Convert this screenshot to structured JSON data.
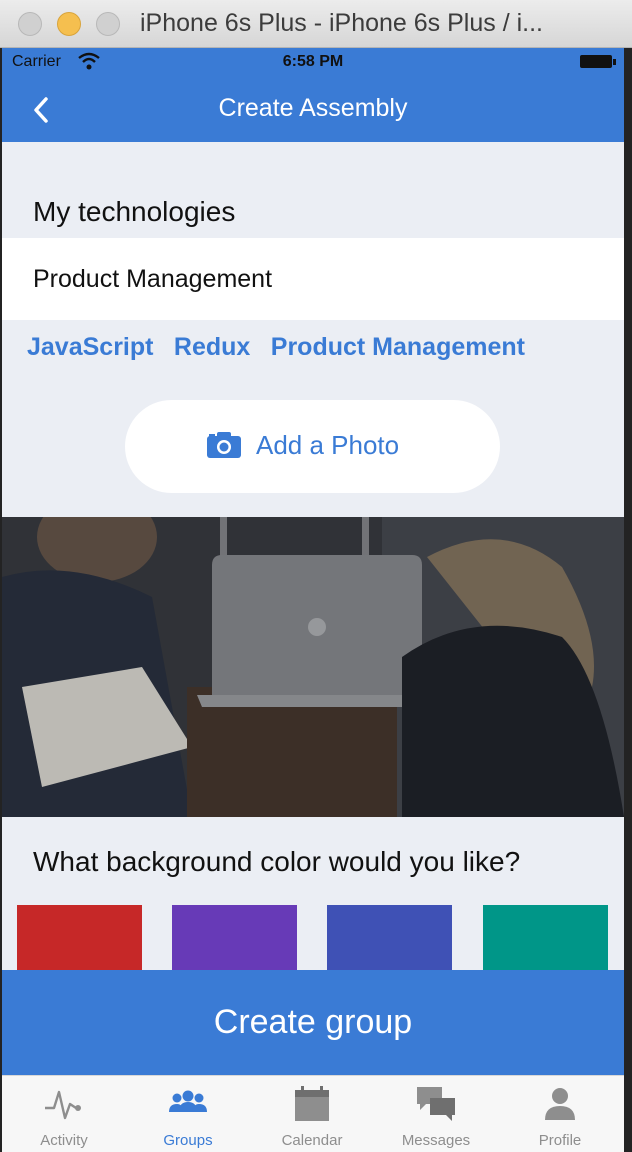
{
  "window": {
    "title": "iPhone 6s Plus - iPhone 6s Plus / i..."
  },
  "status_bar": {
    "carrier": "Carrier",
    "time": "6:58 PM"
  },
  "nav": {
    "title": "Create Assembly",
    "back_icon": "chevron-left-icon"
  },
  "technologies": {
    "label": "My technologies",
    "input_value": "Product Management",
    "tags": [
      "JavaScript",
      "Redux",
      "Product Management"
    ]
  },
  "photo_button": {
    "label": "Add a Photo",
    "icon": "camera-icon"
  },
  "background": {
    "question": "What background color would you like?",
    "swatches": [
      "#c62828",
      "#673ab7",
      "#3f51b5",
      "#009688"
    ]
  },
  "create_button": {
    "label": "Create group"
  },
  "tabs": [
    {
      "label": "Activity",
      "icon": "activity-icon",
      "active": false
    },
    {
      "label": "Groups",
      "icon": "groups-icon",
      "active": true
    },
    {
      "label": "Calendar",
      "icon": "calendar-icon",
      "active": false
    },
    {
      "label": "Messages",
      "icon": "messages-icon",
      "active": false
    },
    {
      "label": "Profile",
      "icon": "profile-icon",
      "active": false
    }
  ],
  "colors": {
    "primary": "#3a7bd5",
    "background": "#ebeef4",
    "tab_inactive": "#8e8e8e"
  }
}
